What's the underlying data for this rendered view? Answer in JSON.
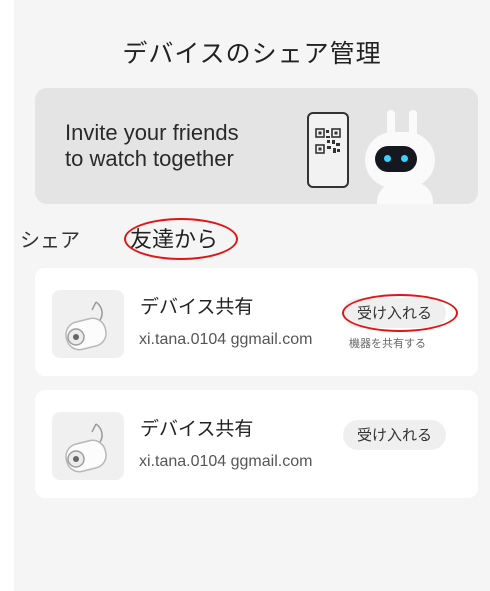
{
  "header": {
    "title": "デバイスのシェア管理"
  },
  "banner": {
    "line1": "Invite your friends",
    "line2": "to watch together"
  },
  "section": {
    "label": "シェア",
    "sub_label": "友達から"
  },
  "shares": [
    {
      "title": "デバイス共有",
      "email": "xi.tana.0104 ggmail.com",
      "accept_label": "受け入れる",
      "hint": "機器を共有する"
    },
    {
      "title": "デバイス共有",
      "email": "xi.tana.0104 ggmail.com",
      "accept_label": "受け入れる"
    }
  ],
  "colors": {
    "background": "#f5f5f5",
    "card": "#ffffff",
    "banner": "#e4e4e4",
    "annotation": "#e01515"
  }
}
